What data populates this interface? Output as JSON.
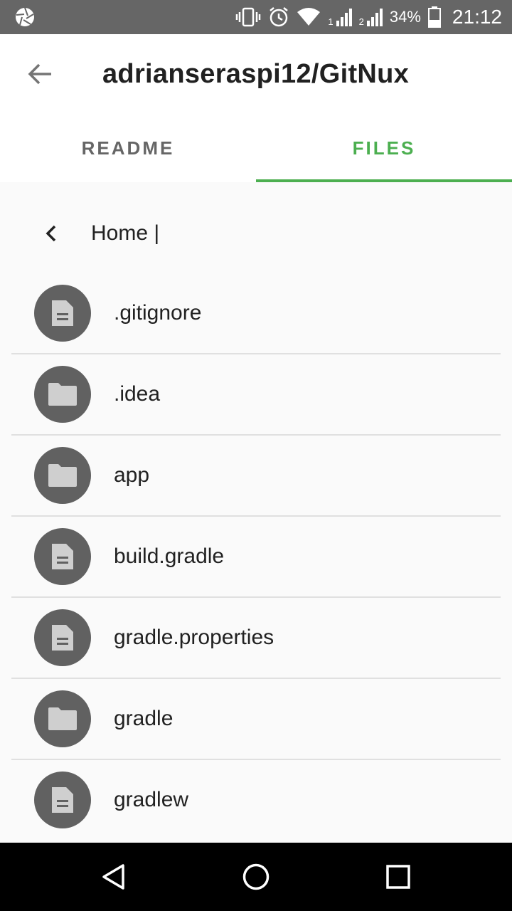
{
  "status_bar": {
    "battery_percent": "34%",
    "time": "21:12",
    "sim1": "1",
    "sim2": "2"
  },
  "app_bar": {
    "title": "adrianseraspi12/GitNux"
  },
  "tabs": [
    {
      "label": "README",
      "active": false
    },
    {
      "label": "FILES",
      "active": true
    }
  ],
  "breadcrumb": {
    "path": "Home |"
  },
  "files": [
    {
      "name": ".gitignore",
      "icon": "file-icon"
    },
    {
      "name": ".idea",
      "icon": "folder-icon"
    },
    {
      "name": "app",
      "icon": "folder-icon"
    },
    {
      "name": "build.gradle",
      "icon": "file-icon"
    },
    {
      "name": "gradle.properties",
      "icon": "file-icon"
    },
    {
      "name": "gradle",
      "icon": "folder-icon"
    },
    {
      "name": "gradlew",
      "icon": "file-icon"
    }
  ],
  "colors": {
    "accent": "#4caf50",
    "status_bar": "#666666",
    "avatar": "#616161",
    "nav_bar": "#000000"
  }
}
